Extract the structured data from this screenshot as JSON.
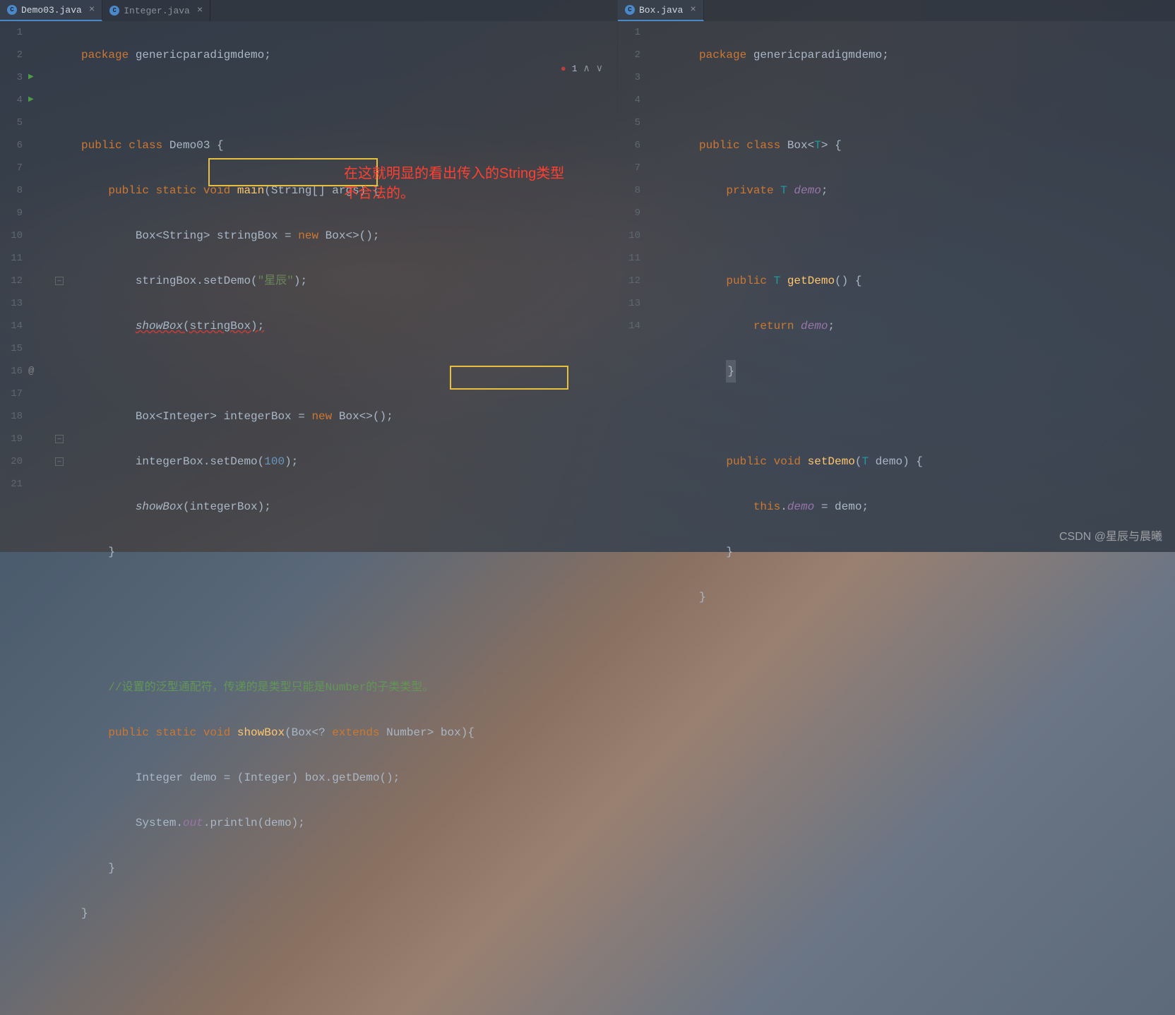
{
  "tabs": {
    "left": [
      {
        "label": "Demo03.java",
        "active": true
      },
      {
        "label": "Integer.java",
        "active": false
      }
    ],
    "right": [
      {
        "label": "Box.java",
        "active": true
      }
    ]
  },
  "error_indicator": {
    "count": "1"
  },
  "annotations": {
    "a1_line1": "在这就明显的看出传入的String类型",
    "a1_line2": "不合法的。"
  },
  "left_code": {
    "lines": [
      "1",
      "2",
      "3",
      "4",
      "5",
      "6",
      "7",
      "8",
      "9",
      "10",
      "11",
      "12",
      "13",
      "14",
      "15",
      "16",
      "17",
      "18",
      "19",
      "20",
      "21"
    ],
    "l1_package": "package ",
    "l1_pkgname": "genericparadigmdemo;",
    "l3_public": "public class ",
    "l3_class": "Demo03 ",
    "l3_brace": "{",
    "l4_prefix": "    ",
    "l4_mods": "public static void ",
    "l4_main": "main",
    "l4_args": "(String[] args) {",
    "l5_prefix": "        ",
    "l5_decl": "Box<String> stringBox = ",
    "l5_new": "new ",
    "l5_ctor": "Box<>();",
    "l6_prefix": "        ",
    "l6_call": "stringBox.setDemo(",
    "l6_str": "\"星辰\"",
    "l6_end": ");",
    "l7_prefix": "        ",
    "l7_show": "showBox",
    "l7_args": "(stringBox);",
    "l9_prefix": "        ",
    "l9_decl": "Box<Integer> integerBox = ",
    "l9_new": "new ",
    "l9_ctor": "Box<>();",
    "l10_prefix": "        ",
    "l10_call": "integerBox.setDemo(",
    "l10_num": "100",
    "l10_end": ");",
    "l11_prefix": "        ",
    "l11_show": "showBox",
    "l11_args": "(integerBox);",
    "l12_prefix": "    ",
    "l12_brace": "}",
    "l15_prefix": "    ",
    "l15_comment": "//设置的泛型通配符，传递的是类型只能是Number的子类类型。",
    "l16_prefix": "    ",
    "l16_mods": "public static void ",
    "l16_method": "showBox",
    "l16_args1": "(Box<? ",
    "l16_extends": "extends ",
    "l16_number": "Number",
    "l16_args2": "> box){",
    "l17_prefix": "        ",
    "l17_code": "Integer demo = (Integer) box.getDemo();",
    "l18_prefix": "        ",
    "l18_sys": "System.",
    "l18_out": "out",
    "l18_rest": ".println(demo);",
    "l19_prefix": "    ",
    "l19_brace": "}",
    "l20_brace": "}"
  },
  "right_code": {
    "lines": [
      "1",
      "2",
      "3",
      "4",
      "5",
      "6",
      "7",
      "8",
      "9",
      "10",
      "11",
      "12",
      "13",
      "14"
    ],
    "l1_package": "package ",
    "l1_pkgname": "genericparadigmdemo;",
    "l3_public": "public class ",
    "l3_class": "Box",
    "l3_tp_open": "<",
    "l3_tp": "T",
    "l3_tp_close": "> {",
    "l4_prefix": "    ",
    "l4_private": "private ",
    "l4_tp": "T ",
    "l4_field": "demo",
    "l4_semi": ";",
    "l6_prefix": "    ",
    "l6_public": "public ",
    "l6_tp": "T ",
    "l6_method": "getDemo",
    "l6_rest": "() {",
    "l7_prefix": "        ",
    "l7_return": "return ",
    "l7_field": "demo",
    "l7_semi": ";",
    "l8_prefix": "    ",
    "l8_brace": "}",
    "l10_prefix": "    ",
    "l10_public": "public void ",
    "l10_method": "setDemo",
    "l10_args1": "(",
    "l10_tp": "T ",
    "l10_args2": "demo) {",
    "l11_prefix": "        ",
    "l11_this": "this",
    "l11_dot": ".",
    "l11_field": "demo",
    "l11_eq": " = demo;",
    "l12_prefix": "    ",
    "l12_brace": "}",
    "l13_brace": "}"
  },
  "watermark": "CSDN @星辰与晨曦"
}
